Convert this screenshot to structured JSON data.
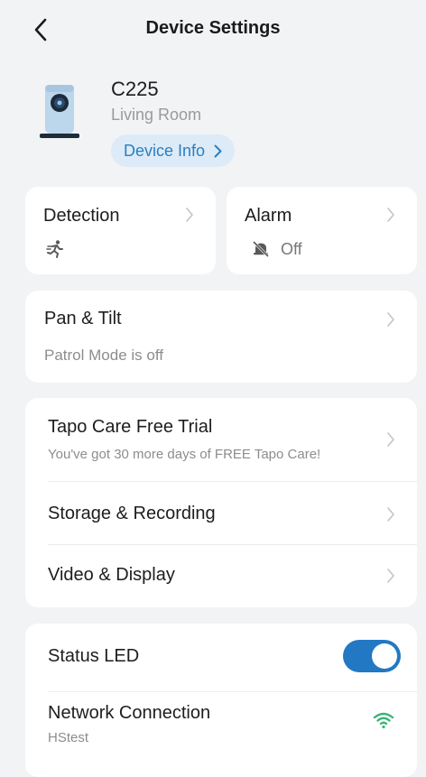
{
  "header": {
    "title": "Device Settings",
    "back_icon": "chevron-left-icon"
  },
  "device": {
    "name": "C225",
    "room": "Living Room",
    "info_button": "Device Info"
  },
  "detection": {
    "label": "Detection",
    "icon": "running-person-icon"
  },
  "alarm": {
    "label": "Alarm",
    "status": "Off",
    "icon": "alarm-off-icon"
  },
  "pan_tilt": {
    "label": "Pan & Tilt",
    "status": "Patrol Mode is off"
  },
  "settings_group": {
    "tapo_care": {
      "label": "Tapo Care Free Trial",
      "sub": "You've got 30 more days of FREE Tapo Care!"
    },
    "storage": {
      "label": "Storage & Recording"
    },
    "video": {
      "label": "Video & Display"
    }
  },
  "status_group": {
    "status_led": {
      "label": "Status LED",
      "enabled": true
    },
    "network": {
      "label": "Network Connection",
      "ssid": "HStest",
      "icon": "wifi-icon"
    }
  },
  "colors": {
    "accent": "#2378c3",
    "wifi": "#3bb37a",
    "info_bg": "#dcebf7"
  }
}
